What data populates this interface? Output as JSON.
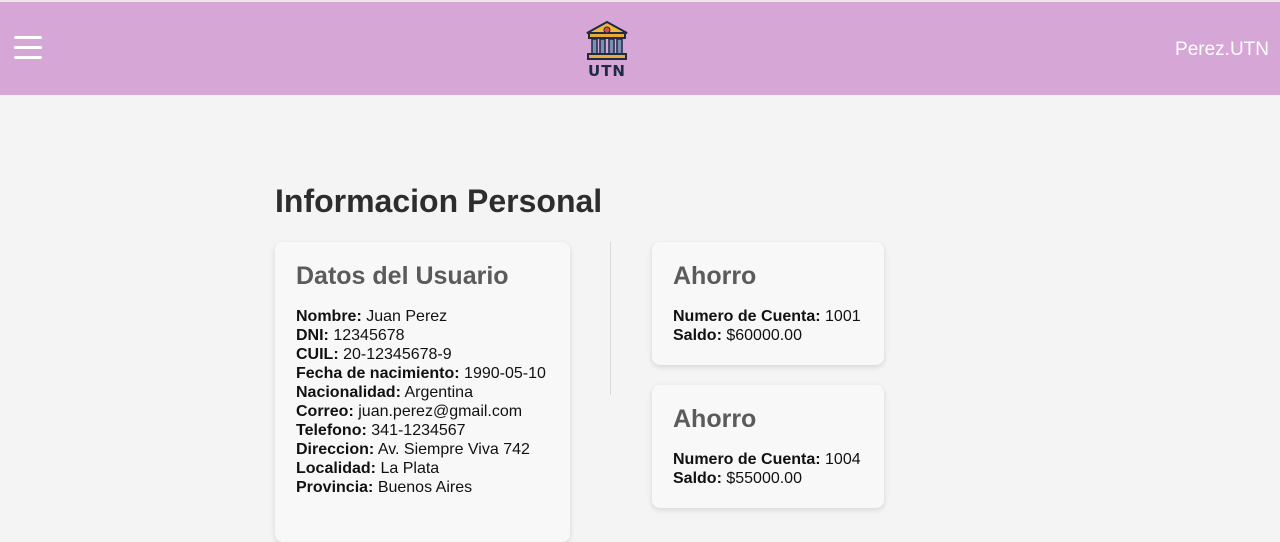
{
  "header": {
    "logo_text": "UTN",
    "username": "Perez.UTN",
    "bg_color": "#d6a6d6"
  },
  "main": {
    "title": "Informacion Personal",
    "user_card": {
      "title": "Datos del Usuario",
      "fields": [
        {
          "label": "Nombre:",
          "value": "Juan Perez"
        },
        {
          "label": "DNI:",
          "value": "12345678"
        },
        {
          "label": "CUIL:",
          "value": "20-12345678-9"
        },
        {
          "label": "Fecha de nacimiento:",
          "value": "1990-05-10"
        },
        {
          "label": "Nacionalidad:",
          "value": "Argentina"
        },
        {
          "label": "Correo:",
          "value": "juan.perez@gmail.com"
        },
        {
          "label": "Telefono:",
          "value": "341-1234567"
        },
        {
          "label": "Direccion:",
          "value": "Av. Siempre Viva 742"
        },
        {
          "label": "Localidad:",
          "value": "La Plata"
        },
        {
          "label": "Provincia:",
          "value": "Buenos Aires"
        }
      ]
    },
    "accounts": [
      {
        "title": "Ahorro",
        "account_label": "Numero de Cuenta:",
        "account_number": "1001",
        "balance_label": "Saldo:",
        "balance": "$60000.00"
      },
      {
        "title": "Ahorro",
        "account_label": "Numero de Cuenta:",
        "account_number": "1004",
        "balance_label": "Saldo:",
        "balance": "$55000.00"
      }
    ]
  }
}
